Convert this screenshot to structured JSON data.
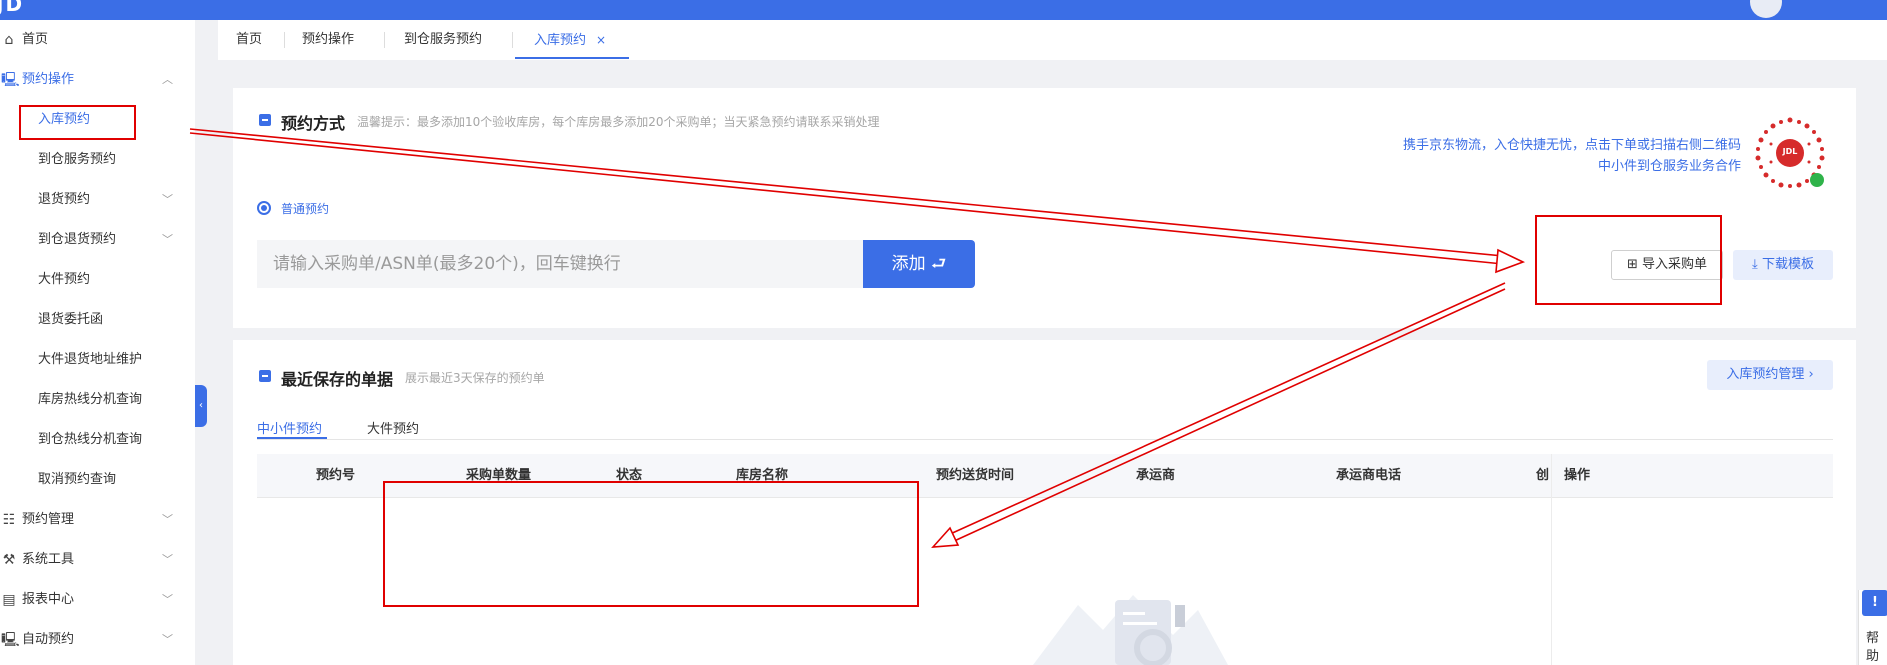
{
  "header": {
    "brand": "JD",
    "accent": "#3b6ee6"
  },
  "sidebar": {
    "items": [
      {
        "label": "首页",
        "icon": "home-icon"
      },
      {
        "label": "预约操作",
        "icon": "monitor-icon"
      },
      {
        "label": "入库预约"
      },
      {
        "label": "到仓服务预约"
      },
      {
        "label": "退货预约"
      },
      {
        "label": "到仓退货预约"
      },
      {
        "label": "大件预约"
      },
      {
        "label": "退货委托函"
      },
      {
        "label": "大件退货地址维护"
      },
      {
        "label": "库房热线分机查询"
      },
      {
        "label": "到仓热线分机查询"
      },
      {
        "label": "取消预约查询"
      },
      {
        "label": "预约管理",
        "icon": "calendar-list-icon"
      },
      {
        "label": "系统工具",
        "icon": "tools-icon"
      },
      {
        "label": "报表中心",
        "icon": "report-icon"
      },
      {
        "label": "自动预约",
        "icon": "monitor-icon"
      }
    ]
  },
  "tabs": [
    {
      "label": "首页"
    },
    {
      "label": "预约操作"
    },
    {
      "label": "到仓服务预约"
    },
    {
      "label": "入库预约",
      "close": "×"
    }
  ],
  "booking": {
    "title": "预约方式",
    "hint": "温馨提示：最多添加10个验收库房，每个库房最多添加20个采购单；当天紧急预约请联系采销处理",
    "promo_line1": "携手京东物流，入仓快捷无忧，点击下单或扫描右侧二维码",
    "promo_line2": "中小件到仓服务业务合作",
    "qr_badge": "JDL",
    "radio_label": "普通预约",
    "input_placeholder": "请输入采购单/ASN单(最多20个)，回车键换行",
    "add_button": "添加 ⮐",
    "import_button": "导入采购单",
    "download_button": "下载模板"
  },
  "recent": {
    "title": "最近保存的单据",
    "hint": "展示最近3天保存的预约单",
    "manage_button": "入库预约管理 ›",
    "subtabs": [
      "中小件预约",
      "大件预约"
    ],
    "columns": [
      "预约号",
      "采购单数量",
      "状态",
      "库房名称",
      "预约送货时间",
      "承运商",
      "承运商电话",
      "创",
      "操作"
    ]
  },
  "help": {
    "label": "帮助",
    "icon_glyph": "!"
  }
}
